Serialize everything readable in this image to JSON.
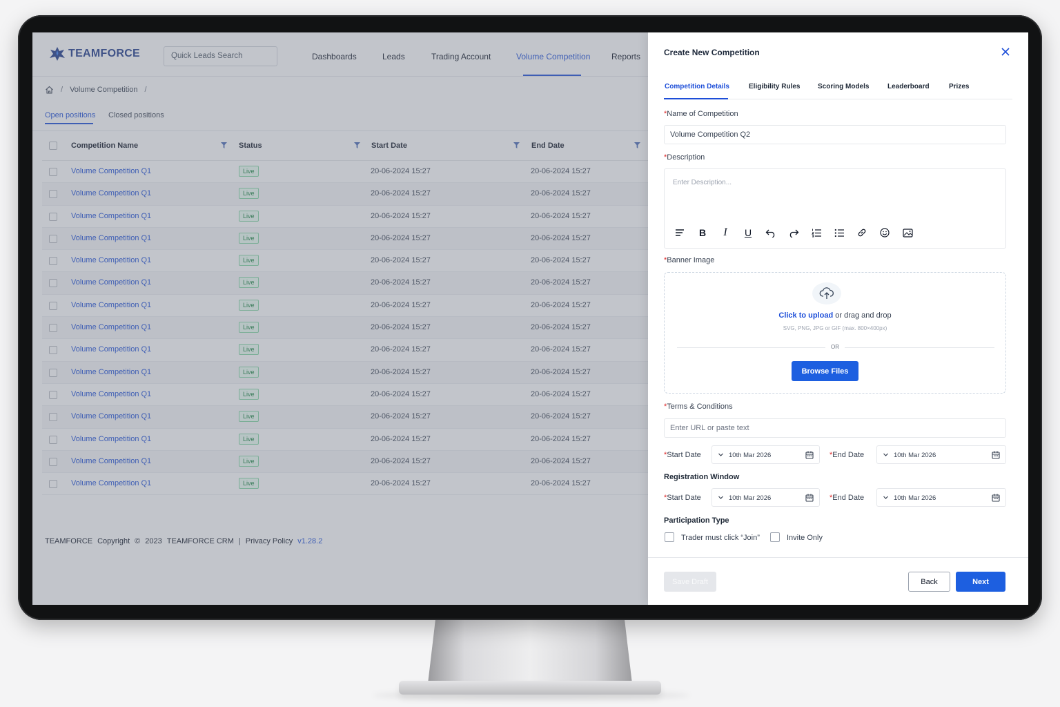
{
  "app": {
    "logo_text": "TEAMFORCE",
    "search_placeholder": "Quick Leads Search",
    "nav": [
      "Dashboards",
      "Leads",
      "Trading Account",
      "Volume Competition",
      "Reports"
    ],
    "active_nav": "Volume Competition",
    "accent": "#1d4ed8"
  },
  "breadcrumb": {
    "page": "Volume Competition",
    "separator": "/"
  },
  "subtabs": [
    "Open positions",
    "Closed positions"
  ],
  "table": {
    "columns": [
      "Competition Name",
      "Status",
      "Start Date",
      "End Date"
    ],
    "rows": [
      {
        "name": "Volume Competition Q1",
        "status": "Live",
        "start": "20-06-2024 15:27",
        "end": "20-06-2024 15:27"
      },
      {
        "name": "Volume Competition Q1",
        "status": "Live",
        "start": "20-06-2024 15:27",
        "end": "20-06-2024 15:27"
      },
      {
        "name": "Volume Competition Q1",
        "status": "Live",
        "start": "20-06-2024 15:27",
        "end": "20-06-2024 15:27"
      },
      {
        "name": "Volume Competition Q1",
        "status": "Live",
        "start": "20-06-2024 15:27",
        "end": "20-06-2024 15:27"
      },
      {
        "name": "Volume Competition Q1",
        "status": "Live",
        "start": "20-06-2024 15:27",
        "end": "20-06-2024 15:27"
      },
      {
        "name": "Volume Competition Q1",
        "status": "Live",
        "start": "20-06-2024 15:27",
        "end": "20-06-2024 15:27"
      },
      {
        "name": "Volume Competition Q1",
        "status": "Live",
        "start": "20-06-2024 15:27",
        "end": "20-06-2024 15:27"
      },
      {
        "name": "Volume Competition Q1",
        "status": "Live",
        "start": "20-06-2024 15:27",
        "end": "20-06-2024 15:27"
      },
      {
        "name": "Volume Competition Q1",
        "status": "Live",
        "start": "20-06-2024 15:27",
        "end": "20-06-2024 15:27"
      },
      {
        "name": "Volume Competition Q1",
        "status": "Live",
        "start": "20-06-2024 15:27",
        "end": "20-06-2024 15:27"
      },
      {
        "name": "Volume Competition Q1",
        "status": "Live",
        "start": "20-06-2024 15:27",
        "end": "20-06-2024 15:27"
      },
      {
        "name": "Volume Competition Q1",
        "status": "Live",
        "start": "20-06-2024 15:27",
        "end": "20-06-2024 15:27"
      },
      {
        "name": "Volume Competition Q1",
        "status": "Live",
        "start": "20-06-2024 15:27",
        "end": "20-06-2024 15:27"
      },
      {
        "name": "Volume Competition Q1",
        "status": "Live",
        "start": "20-06-2024 15:27",
        "end": "20-06-2024 15:27"
      },
      {
        "name": "Volume Competition Q1",
        "status": "Live",
        "start": "20-06-2024 15:27",
        "end": "20-06-2024 15:27"
      }
    ]
  },
  "footer": {
    "brand": "TEAMFORCE",
    "copyright": "Copyright",
    "symbol": "©",
    "year": "2023",
    "product": "TEAMFORCE CRM",
    "divider": "|",
    "privacy": "Privacy Policy",
    "version": "v1.28.2"
  },
  "panel": {
    "title": "Create New Competition",
    "tabs": [
      "Competition Details",
      "Eligibility Rules",
      "Scoring Models",
      "Leaderboard",
      "Prizes"
    ],
    "name_label": "Name of Competition",
    "name_value": "Volume Competition Q2",
    "description_label": "Description",
    "description_placeholder": "Enter Description...",
    "banner_label": "Banner Image",
    "upload_link": "Click to upload",
    "upload_rest": " or drag and drop",
    "upload_hint": "SVG, PNG, JPG or GIF (max. 800×400px)",
    "or_text": "OR",
    "browse_label": "Browse Files",
    "terms_label": "Terms & Conditions",
    "terms_placeholder": "Enter URL or paste text",
    "start_date_label": "Start Date",
    "end_date_label": "End Date",
    "start_date_value": "10th Mar 2026",
    "end_date_value": "10th Mar 2026",
    "reg_title": "Registration Window",
    "reg_start_label": "Start Date",
    "reg_end_label": "End Date",
    "reg_start_value": "10th Mar 2026",
    "reg_end_value": "10th Mar 2026",
    "participation_title": "Participation Type",
    "opt_join": "Trader must click “Join”",
    "opt_invite": "Invite Only",
    "save_draft": "Save Draft",
    "back": "Back",
    "next": "Next"
  }
}
